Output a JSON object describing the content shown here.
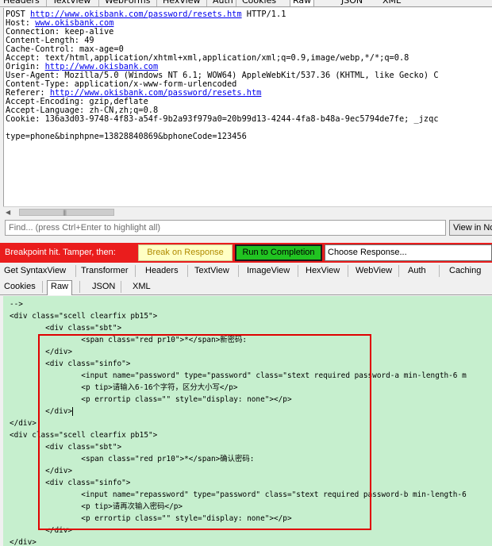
{
  "top_tabs": [
    "Headers",
    "TextView",
    "WebForms",
    "HexView",
    "Auth",
    "Cookies",
    "Raw",
    "JSON",
    "XML"
  ],
  "request": {
    "method": "POST",
    "url": "http://www.okisbank.com/password/resets.htm",
    "protocol": "HTTP/1.1",
    "host_label": "Host:",
    "host_value": "www.okisbank.com",
    "connection": "Connection: keep-alive",
    "content_length": "Content-Length: 49",
    "cache_control": "Cache-Control: max-age=0",
    "accept": "Accept: text/html,application/xhtml+xml,application/xml;q=0.9,image/webp,*/*;q=0.8",
    "origin_label": "Origin:",
    "origin_value": "http://www.okisbank.com",
    "user_agent": "User-Agent: Mozilla/5.0 (Windows NT 6.1; WOW64) AppleWebKit/537.36 (KHTML, like Gecko) C",
    "content_type": "Content-Type: application/x-www-form-urlencoded",
    "referer_label": "Referer:",
    "referer_value": "http://www.okisbank.com/password/resets.htm",
    "accept_encoding": "Accept-Encoding: gzip,deflate",
    "accept_language": "Accept-Language: zh-CN,zh;q=0.8",
    "cookie": "Cookie: 136a3d03-9748-4f83-a54f-9b2a93f979a0=20b99d13-4244-4fa8-b48a-9ec5794de7fe; _jzqc",
    "body": "type=phone&binphpne=13828840869&bphoneCode=123456"
  },
  "scrollbar": {
    "grip": "|||"
  },
  "find": {
    "placeholder": "Find... (press Ctrl+Enter to highlight all)",
    "view_in_label": "View in No"
  },
  "breakpoint": {
    "message": "Breakpoint hit. Tamper, then:",
    "break_on_response": "Break on Response",
    "run_to_completion": "Run to Completion",
    "choose_response": "Choose Response..."
  },
  "response_tabs_row1": [
    "Get SyntaxView",
    "Transformer",
    "Headers",
    "TextView",
    "ImageView",
    "HexView",
    "WebView",
    "Auth",
    "Caching"
  ],
  "response_tabs_row2": [
    "Cookies",
    "Raw",
    "JSON",
    "XML"
  ],
  "response_code": [
    "-->",
    "<div class=\"scell clearfix pb15\">",
    "        <div class=\"sbt\">",
    "                <span class=\"red pr10\">*</span>新密码:",
    "        </div>",
    "        <div class=\"sinfo\">",
    "                <input name=\"password\" type=\"password\" class=\"stext required password-a min-length-6 m",
    "                <p tip>请输入6-16个字符，区分大小写</p>",
    "                <p errortip class=\"\" style=\"display: none\"></p>",
    "        </div>",
    "</div>",
    "<div class=\"scell clearfix pb15\">",
    "        <div class=\"sbt\">",
    "                <span class=\"red pr10\">*</span>确认密码:",
    "        </div>",
    "        <div class=\"sinfo\">",
    "                <input name=\"repassword\" type=\"password\" class=\"stext required password-b min-length-6",
    "                <p tip>请再次输入密码</p>",
    "                <p errortip class=\"\" style=\"display: none\"></p>",
    "        </div>",
    "</div>"
  ]
}
